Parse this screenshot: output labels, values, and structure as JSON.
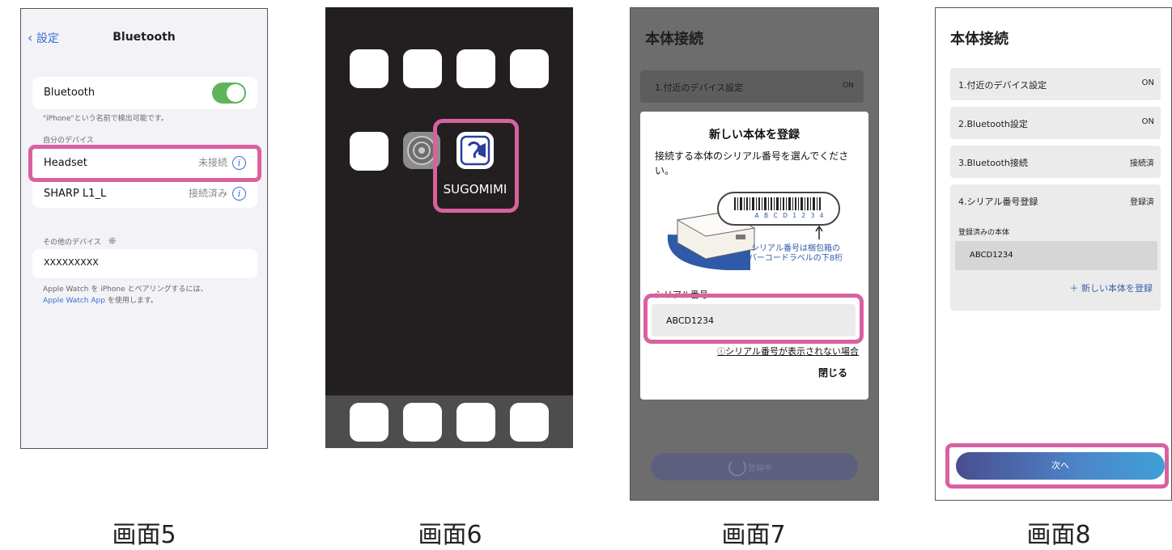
{
  "captions": [
    "画面5",
    "画面6",
    "画面7",
    "画面8"
  ],
  "screen5": {
    "back_label": "設定",
    "title": "Bluetooth",
    "bluetooth_label": "Bluetooth",
    "bluetooth_on": true,
    "discoverable_note": "\"iPhone\"という名前で検出可能です。",
    "my_devices_header": "自分のデバイス",
    "devices": [
      {
        "name": "Headset",
        "status": "未接続"
      },
      {
        "name": "SHARP L1_L",
        "status": "接続済み"
      }
    ],
    "other_devices_header": "その他のデバイス",
    "other_device": "XXXXXXXXX",
    "watch_note_line1": "Apple Watch を iPhone とペアリングするには、",
    "watch_note_link": "Apple Watch App",
    "watch_note_line2": "を使用します。"
  },
  "screen6": {
    "app_name": "SUGOMIMI",
    "icons": [
      "settings-icon",
      "sugomimi-icon"
    ]
  },
  "screen7": {
    "header": "本体接続",
    "row1_label": "1.付近のデバイス設定",
    "row1_value": "ON",
    "modal_title": "新しい本体を登録",
    "modal_desc": "接続する本体のシリアル番号を選んでください。",
    "barcode_text": "A B C D 1 2 3 4",
    "illus_note_line1": "シリアル番号は梱包箱の",
    "illus_note_line2": "バーコードラベルの下8桁",
    "serial_label": "シリアル番号",
    "serial_value": "ABCD1234",
    "help_link": "シリアル番号が表示されない場合",
    "close_label": "閉じる",
    "footer_button": "登録中"
  },
  "screen8": {
    "header": "本体接続",
    "steps": [
      {
        "label": "1.付近のデバイス設定",
        "value": "ON"
      },
      {
        "label": "2.Bluetooth設定",
        "value": "ON"
      },
      {
        "label": "3.Bluetooth接続",
        "value": "接続済"
      },
      {
        "label": "4.シリアル番号登録",
        "value": "登録済"
      }
    ],
    "registered_label": "登録済みの本体",
    "registered_value": "ABCD1234",
    "add_new_label": "＋ 新しい本体を登録",
    "next_label": "次へ"
  },
  "colors": {
    "highlight": "#d9619f",
    "toggle_on": "#5fb45a",
    "ios_blue": "#3a6fd8",
    "next_gradient_start": "#4a4d8f",
    "next_gradient_end": "#3fa0d8"
  }
}
